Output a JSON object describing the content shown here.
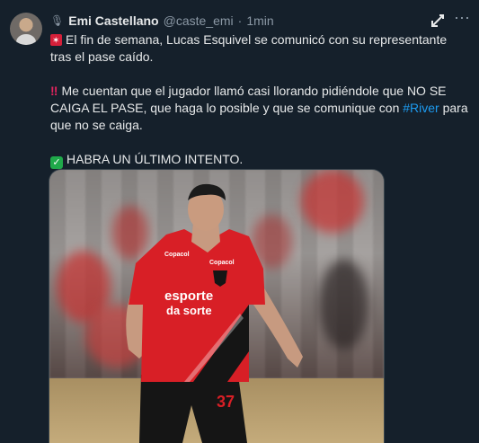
{
  "tweet": {
    "author_name": "Emi Castellano",
    "handle": "@caste_emi",
    "separator": "·",
    "time": "1min",
    "paragraphs": {
      "p1": "El fin de semana, Lucas Esquivel se comunicó con su representante tras el pase caído.",
      "p2_before": "Me cuentan que el jugador llamó casi llorando pidiéndole que NO SE CAIGA EL PASE, que haga lo posible y que se comunique con ",
      "p2_hashtag": "#River",
      "p2_after": " para que no se caiga.",
      "p3": "HABRA UN ÚLTIMO INTENTO."
    },
    "icons": {
      "mic": "microphone-icon",
      "flag": "red-flag-emoji-icon",
      "bang": "double-exclamation-icon",
      "check": "check-mark-emoji-icon",
      "grok": "grok-icon",
      "more": "more-options-icon"
    },
    "image": {
      "jersey_sponsor_top": "Copacol",
      "jersey_sponsor_brand": "Copacol",
      "jersey_main_sponsor_1": "esporte",
      "jersey_main_sponsor_2": "da sorte",
      "shorts_number": "37"
    }
  },
  "colors": {
    "background": "#15202b",
    "text": "#e7e9ea",
    "muted": "#8b98a5",
    "link": "#1d9bf0",
    "jersey_red": "#d81f26",
    "jersey_black": "#151515"
  }
}
